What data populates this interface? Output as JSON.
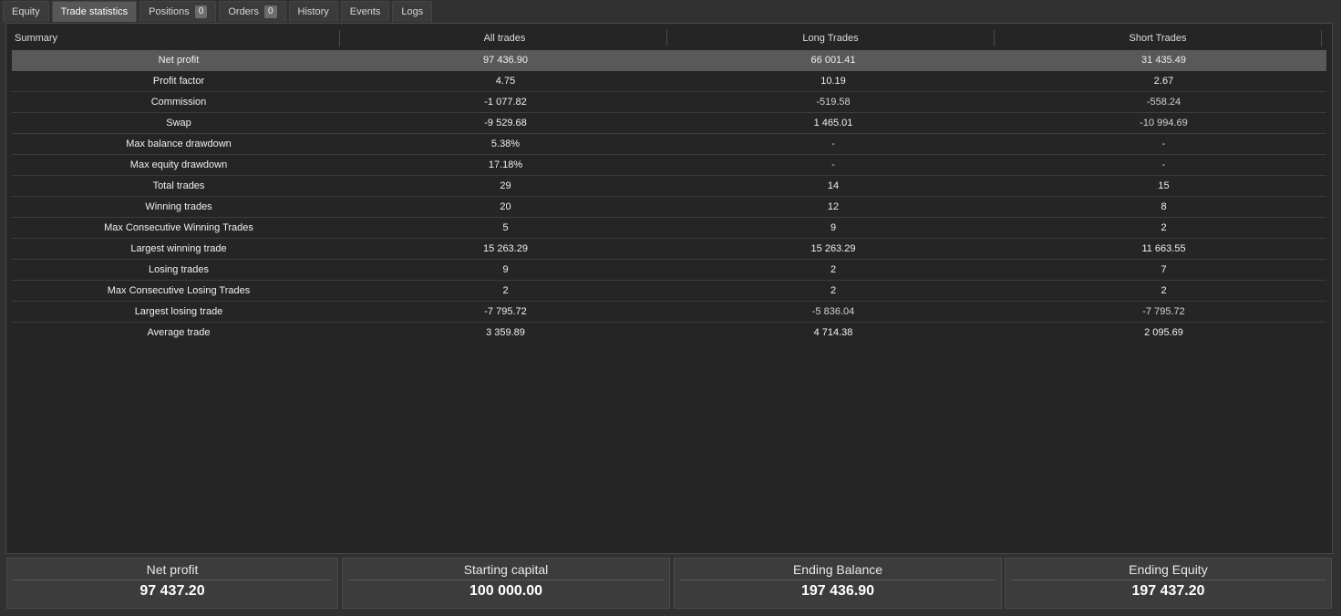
{
  "tabs": [
    {
      "label": "Equity"
    },
    {
      "label": "Trade statistics"
    },
    {
      "label": "Positions",
      "badge": "0"
    },
    {
      "label": "Orders",
      "badge": "0"
    },
    {
      "label": "History"
    },
    {
      "label": "Events"
    },
    {
      "label": "Logs"
    }
  ],
  "table": {
    "headers": [
      "Summary",
      "All trades",
      "Long Trades",
      "Short Trades"
    ],
    "rows": [
      [
        "Net profit",
        "97 436.90",
        "66 001.41",
        "31 435.49"
      ],
      [
        "Profit factor",
        "4.75",
        "10.19",
        "2.67"
      ],
      [
        "Commission",
        "-1 077.82",
        "-519.58",
        "-558.24"
      ],
      [
        "Swap",
        "-9 529.68",
        "1 465.01",
        "-10 994.69"
      ],
      [
        "Max balance drawdown",
        "5.38%",
        "-",
        "-"
      ],
      [
        "Max equity drawdown",
        "17.18%",
        "-",
        "-"
      ],
      [
        "Total trades",
        "29",
        "14",
        "15"
      ],
      [
        "Winning trades",
        "20",
        "12",
        "8"
      ],
      [
        "Max Consecutive Winning Trades",
        "5",
        "9",
        "2"
      ],
      [
        "Largest winning trade",
        "15 263.29",
        "15 263.29",
        "11 663.55"
      ],
      [
        "Losing trades",
        "9",
        "2",
        "7"
      ],
      [
        "Max Consecutive Losing Trades",
        "2",
        "2",
        "2"
      ],
      [
        "Largest losing trade",
        "-7 795.72",
        "-5 836.04",
        "-7 795.72"
      ],
      [
        "Average trade",
        "3 359.89",
        "4 714.38",
        "2 095.69"
      ]
    ]
  },
  "summary_cards": [
    {
      "label": "Net profit",
      "value": "97 437.20"
    },
    {
      "label": "Starting capital",
      "value": "100 000.00"
    },
    {
      "label": "Ending Balance",
      "value": "197 436.90"
    },
    {
      "label": "Ending Equity",
      "value": "197 437.20"
    }
  ]
}
